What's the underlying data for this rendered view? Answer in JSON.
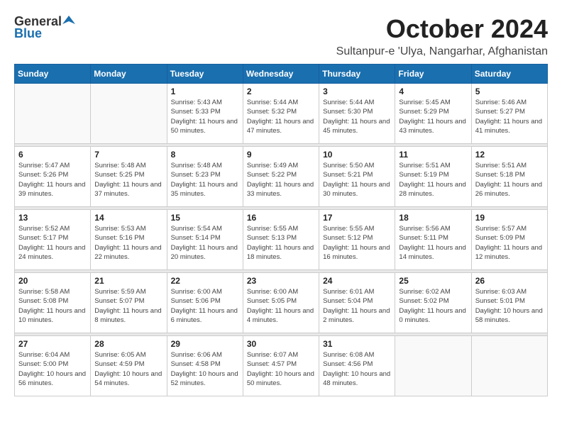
{
  "logo": {
    "general": "General",
    "blue": "Blue"
  },
  "title": {
    "month": "October 2024",
    "location": "Sultanpur-e 'Ulya, Nangarhar, Afghanistan"
  },
  "headers": [
    "Sunday",
    "Monday",
    "Tuesday",
    "Wednesday",
    "Thursday",
    "Friday",
    "Saturday"
  ],
  "weeks": [
    [
      {
        "day": "",
        "sunrise": "",
        "sunset": "",
        "daylight": ""
      },
      {
        "day": "",
        "sunrise": "",
        "sunset": "",
        "daylight": ""
      },
      {
        "day": "1",
        "sunrise": "Sunrise: 5:43 AM",
        "sunset": "Sunset: 5:33 PM",
        "daylight": "Daylight: 11 hours and 50 minutes."
      },
      {
        "day": "2",
        "sunrise": "Sunrise: 5:44 AM",
        "sunset": "Sunset: 5:32 PM",
        "daylight": "Daylight: 11 hours and 47 minutes."
      },
      {
        "day": "3",
        "sunrise": "Sunrise: 5:44 AM",
        "sunset": "Sunset: 5:30 PM",
        "daylight": "Daylight: 11 hours and 45 minutes."
      },
      {
        "day": "4",
        "sunrise": "Sunrise: 5:45 AM",
        "sunset": "Sunset: 5:29 PM",
        "daylight": "Daylight: 11 hours and 43 minutes."
      },
      {
        "day": "5",
        "sunrise": "Sunrise: 5:46 AM",
        "sunset": "Sunset: 5:27 PM",
        "daylight": "Daylight: 11 hours and 41 minutes."
      }
    ],
    [
      {
        "day": "6",
        "sunrise": "Sunrise: 5:47 AM",
        "sunset": "Sunset: 5:26 PM",
        "daylight": "Daylight: 11 hours and 39 minutes."
      },
      {
        "day": "7",
        "sunrise": "Sunrise: 5:48 AM",
        "sunset": "Sunset: 5:25 PM",
        "daylight": "Daylight: 11 hours and 37 minutes."
      },
      {
        "day": "8",
        "sunrise": "Sunrise: 5:48 AM",
        "sunset": "Sunset: 5:23 PM",
        "daylight": "Daylight: 11 hours and 35 minutes."
      },
      {
        "day": "9",
        "sunrise": "Sunrise: 5:49 AM",
        "sunset": "Sunset: 5:22 PM",
        "daylight": "Daylight: 11 hours and 33 minutes."
      },
      {
        "day": "10",
        "sunrise": "Sunrise: 5:50 AM",
        "sunset": "Sunset: 5:21 PM",
        "daylight": "Daylight: 11 hours and 30 minutes."
      },
      {
        "day": "11",
        "sunrise": "Sunrise: 5:51 AM",
        "sunset": "Sunset: 5:19 PM",
        "daylight": "Daylight: 11 hours and 28 minutes."
      },
      {
        "day": "12",
        "sunrise": "Sunrise: 5:51 AM",
        "sunset": "Sunset: 5:18 PM",
        "daylight": "Daylight: 11 hours and 26 minutes."
      }
    ],
    [
      {
        "day": "13",
        "sunrise": "Sunrise: 5:52 AM",
        "sunset": "Sunset: 5:17 PM",
        "daylight": "Daylight: 11 hours and 24 minutes."
      },
      {
        "day": "14",
        "sunrise": "Sunrise: 5:53 AM",
        "sunset": "Sunset: 5:16 PM",
        "daylight": "Daylight: 11 hours and 22 minutes."
      },
      {
        "day": "15",
        "sunrise": "Sunrise: 5:54 AM",
        "sunset": "Sunset: 5:14 PM",
        "daylight": "Daylight: 11 hours and 20 minutes."
      },
      {
        "day": "16",
        "sunrise": "Sunrise: 5:55 AM",
        "sunset": "Sunset: 5:13 PM",
        "daylight": "Daylight: 11 hours and 18 minutes."
      },
      {
        "day": "17",
        "sunrise": "Sunrise: 5:55 AM",
        "sunset": "Sunset: 5:12 PM",
        "daylight": "Daylight: 11 hours and 16 minutes."
      },
      {
        "day": "18",
        "sunrise": "Sunrise: 5:56 AM",
        "sunset": "Sunset: 5:11 PM",
        "daylight": "Daylight: 11 hours and 14 minutes."
      },
      {
        "day": "19",
        "sunrise": "Sunrise: 5:57 AM",
        "sunset": "Sunset: 5:09 PM",
        "daylight": "Daylight: 11 hours and 12 minutes."
      }
    ],
    [
      {
        "day": "20",
        "sunrise": "Sunrise: 5:58 AM",
        "sunset": "Sunset: 5:08 PM",
        "daylight": "Daylight: 11 hours and 10 minutes."
      },
      {
        "day": "21",
        "sunrise": "Sunrise: 5:59 AM",
        "sunset": "Sunset: 5:07 PM",
        "daylight": "Daylight: 11 hours and 8 minutes."
      },
      {
        "day": "22",
        "sunrise": "Sunrise: 6:00 AM",
        "sunset": "Sunset: 5:06 PM",
        "daylight": "Daylight: 11 hours and 6 minutes."
      },
      {
        "day": "23",
        "sunrise": "Sunrise: 6:00 AM",
        "sunset": "Sunset: 5:05 PM",
        "daylight": "Daylight: 11 hours and 4 minutes."
      },
      {
        "day": "24",
        "sunrise": "Sunrise: 6:01 AM",
        "sunset": "Sunset: 5:04 PM",
        "daylight": "Daylight: 11 hours and 2 minutes."
      },
      {
        "day": "25",
        "sunrise": "Sunrise: 6:02 AM",
        "sunset": "Sunset: 5:02 PM",
        "daylight": "Daylight: 11 hours and 0 minutes."
      },
      {
        "day": "26",
        "sunrise": "Sunrise: 6:03 AM",
        "sunset": "Sunset: 5:01 PM",
        "daylight": "Daylight: 10 hours and 58 minutes."
      }
    ],
    [
      {
        "day": "27",
        "sunrise": "Sunrise: 6:04 AM",
        "sunset": "Sunset: 5:00 PM",
        "daylight": "Daylight: 10 hours and 56 minutes."
      },
      {
        "day": "28",
        "sunrise": "Sunrise: 6:05 AM",
        "sunset": "Sunset: 4:59 PM",
        "daylight": "Daylight: 10 hours and 54 minutes."
      },
      {
        "day": "29",
        "sunrise": "Sunrise: 6:06 AM",
        "sunset": "Sunset: 4:58 PM",
        "daylight": "Daylight: 10 hours and 52 minutes."
      },
      {
        "day": "30",
        "sunrise": "Sunrise: 6:07 AM",
        "sunset": "Sunset: 4:57 PM",
        "daylight": "Daylight: 10 hours and 50 minutes."
      },
      {
        "day": "31",
        "sunrise": "Sunrise: 6:08 AM",
        "sunset": "Sunset: 4:56 PM",
        "daylight": "Daylight: 10 hours and 48 minutes."
      },
      {
        "day": "",
        "sunrise": "",
        "sunset": "",
        "daylight": ""
      },
      {
        "day": "",
        "sunrise": "",
        "sunset": "",
        "daylight": ""
      }
    ]
  ]
}
